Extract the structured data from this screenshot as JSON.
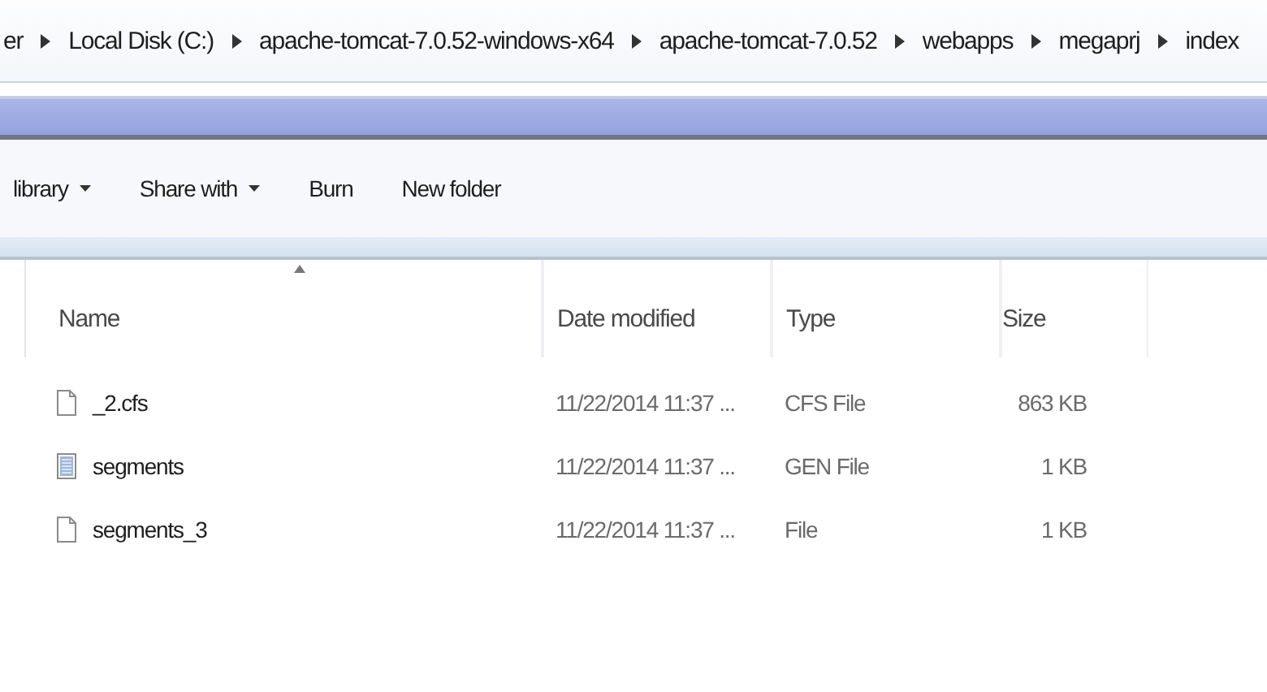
{
  "breadcrumb": [
    "er",
    "Local Disk (C:)",
    "apache-tomcat-7.0.52-windows-x64",
    "apache-tomcat-7.0.52",
    "webapps",
    "megaprj",
    "index"
  ],
  "toolbar": [
    {
      "label": "library",
      "dropdown": true
    },
    {
      "label": "Share with",
      "dropdown": true
    },
    {
      "label": "Burn",
      "dropdown": false
    },
    {
      "label": "New folder",
      "dropdown": false
    }
  ],
  "table": {
    "columns": [
      {
        "label": "Name",
        "sorted": true
      },
      {
        "label": "Date modified",
        "sorted": false
      },
      {
        "label": "Type",
        "sorted": false
      },
      {
        "label": "Size",
        "sorted": false
      }
    ],
    "rows": [
      {
        "kind": "blank",
        "name": "_2.cfs",
        "date": "11/22/2014 11:37 ...",
        "type": "CFS File",
        "size": "863 KB"
      },
      {
        "kind": "lines",
        "name": "segments",
        "date": "11/22/2014 11:37 ...",
        "type": "GEN File",
        "size": "1 KB"
      },
      {
        "kind": "blank",
        "name": "segments_3",
        "date": "11/22/2014 11:37 ...",
        "type": "File",
        "size": "1 KB"
      }
    ]
  }
}
